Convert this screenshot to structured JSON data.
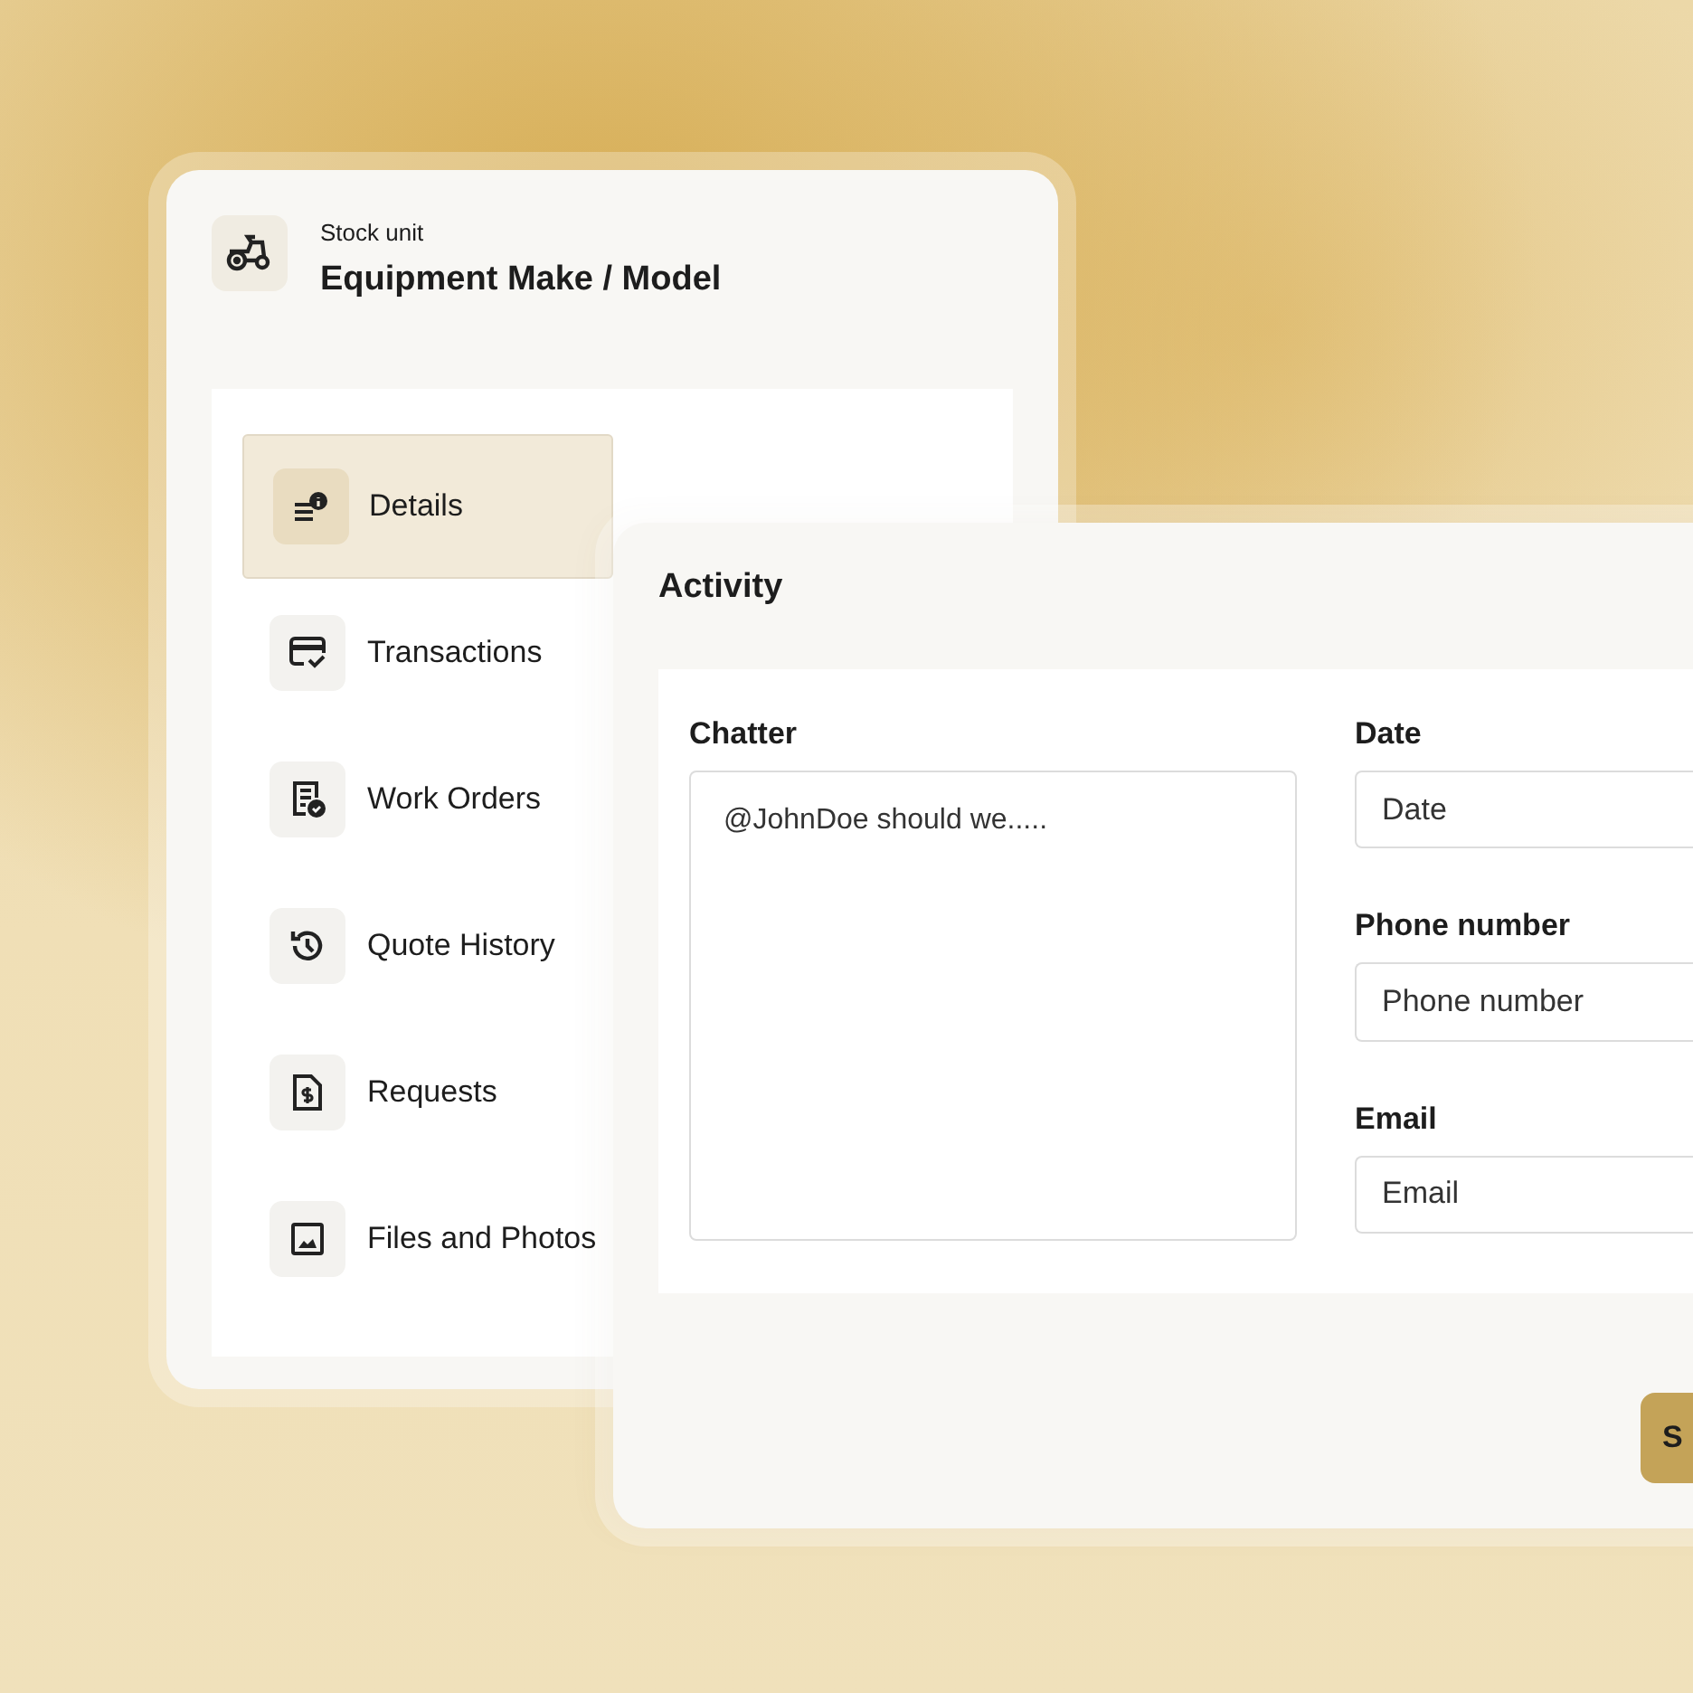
{
  "header": {
    "subtitle": "Stock unit",
    "title": "Equipment Make / Model"
  },
  "nav": [
    {
      "label": "Details",
      "selected": true
    },
    {
      "label": "Transactions",
      "selected": false
    },
    {
      "label": "Work Orders",
      "selected": false
    },
    {
      "label": "Quote History",
      "selected": false
    },
    {
      "label": "Requests",
      "selected": false
    },
    {
      "label": "Files and Photos",
      "selected": false
    }
  ],
  "activity": {
    "title": "Activity",
    "chatter": {
      "label": "Chatter",
      "value": "@JohnDoe should we....."
    },
    "fields": [
      {
        "label": "Date",
        "placeholder": "Date"
      },
      {
        "label": "Phone number",
        "placeholder": "Phone number"
      },
      {
        "label": "Email",
        "placeholder": "Email"
      }
    ],
    "save_button": "S"
  }
}
